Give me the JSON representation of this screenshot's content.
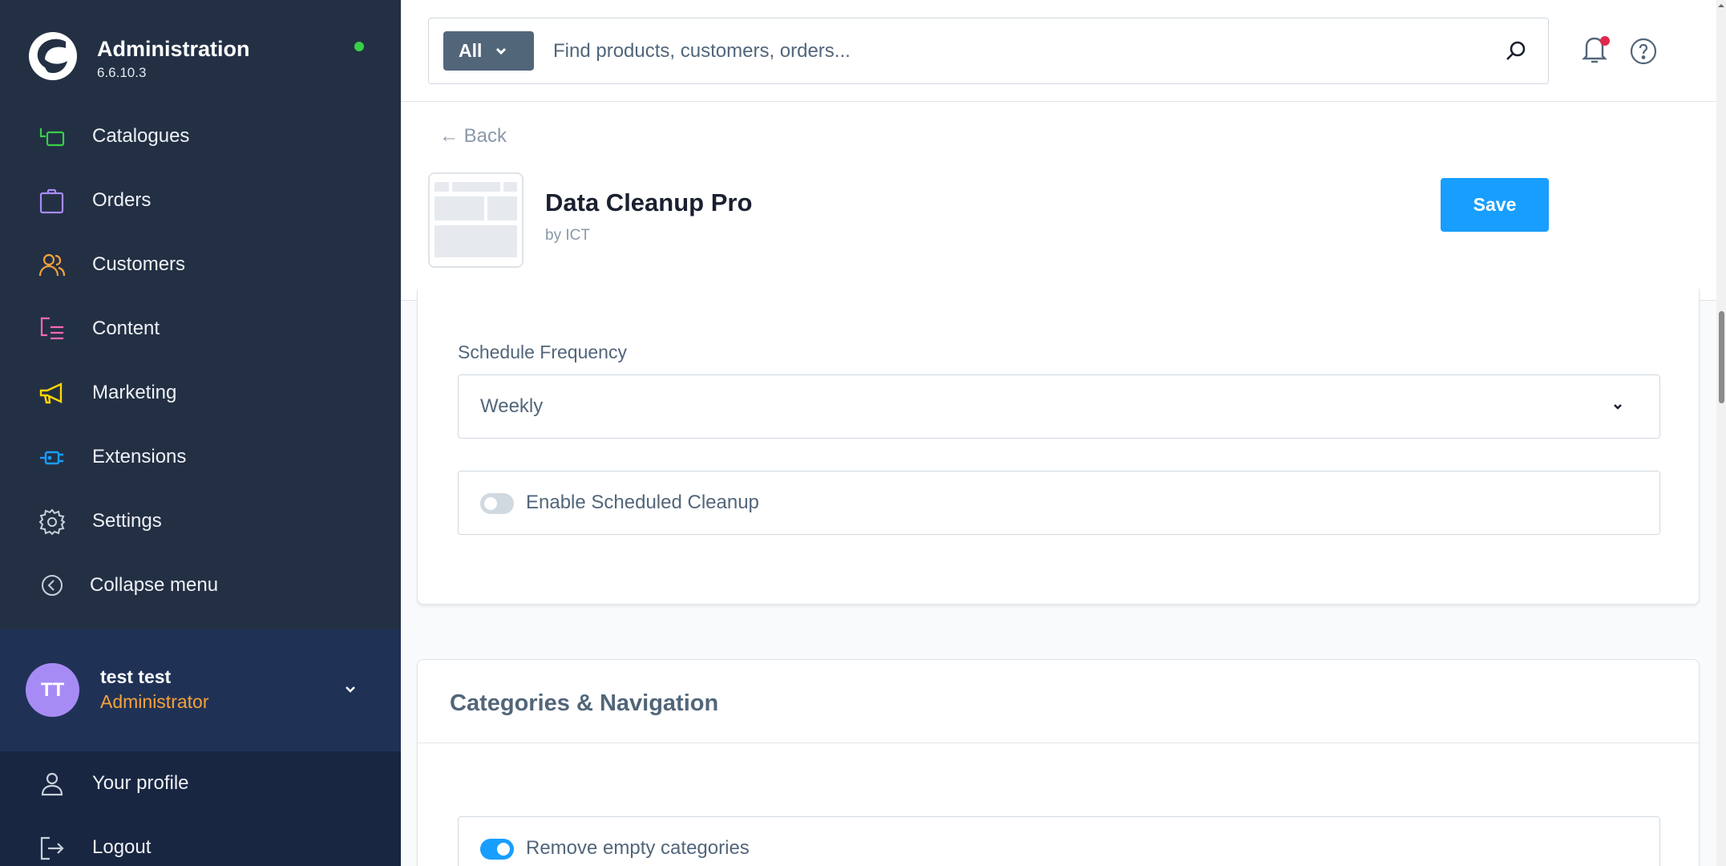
{
  "brand": {
    "title": "Administration",
    "version": "6.6.10.3"
  },
  "nav": {
    "catalogues": "Catalogues",
    "orders": "Orders",
    "customers": "Customers",
    "content": "Content",
    "marketing": "Marketing",
    "extensions": "Extensions",
    "settings": "Settings",
    "collapse": "Collapse menu"
  },
  "user": {
    "initials": "TT",
    "name": "test test",
    "role": "Administrator"
  },
  "account": {
    "profile": "Your profile",
    "logout": "Logout"
  },
  "search": {
    "type": "All",
    "placeholder": "Find products, customers, orders..."
  },
  "header": {
    "back": "← Back",
    "app_name": "Data Cleanup Pro",
    "vendor": "by ICT",
    "save": "Save"
  },
  "schedule": {
    "frequency_label": "Schedule Frequency",
    "frequency_value": "Weekly",
    "enable_label": "Enable Scheduled Cleanup",
    "enable_on": false
  },
  "categories": {
    "title": "Categories & Navigation",
    "remove_empty_label": "Remove empty categories",
    "remove_empty_on": true
  },
  "colors": {
    "sidebar": "#233044",
    "accent": "#189eff",
    "role": "#f7a23b",
    "status": "#37d046"
  }
}
